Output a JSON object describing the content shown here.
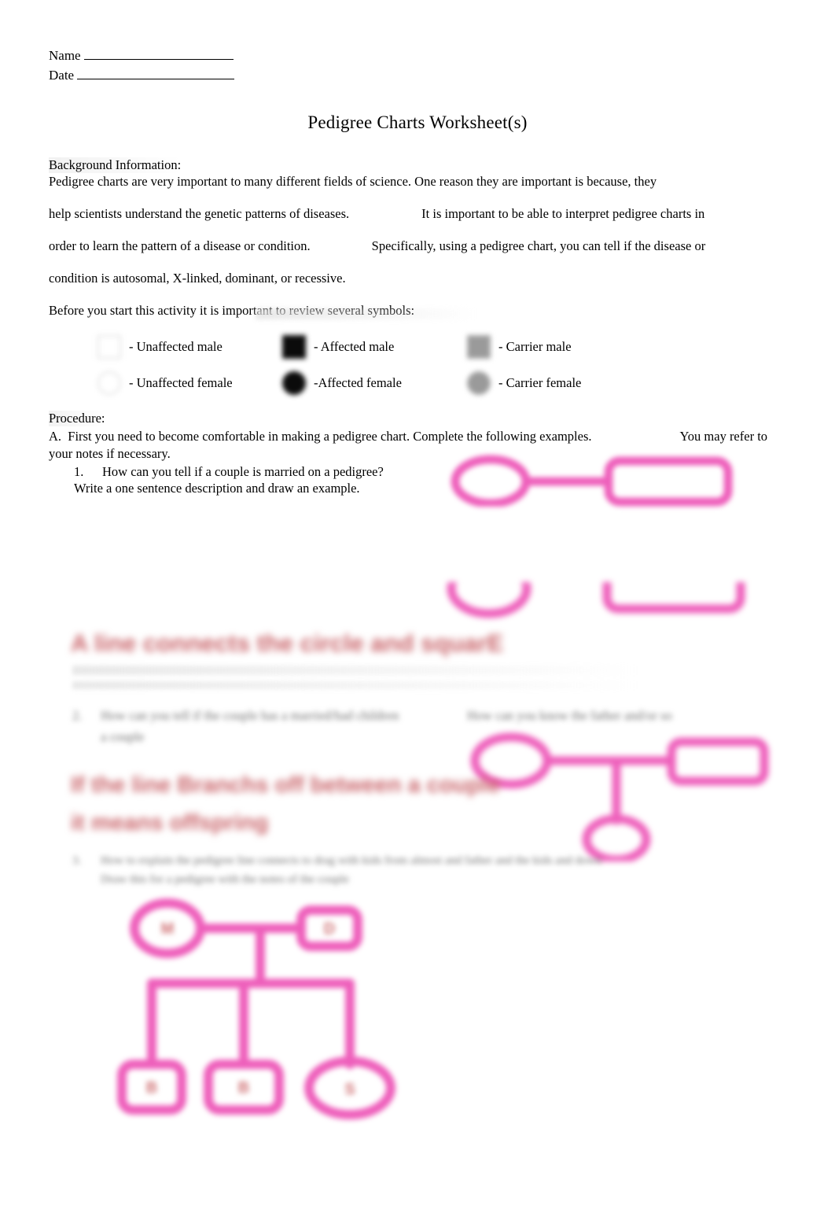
{
  "header": {
    "name_label": "Name",
    "date_label": "Date"
  },
  "title": "Pedigree Charts Worksheet(s)",
  "background": {
    "heading": "Background Information:",
    "line1": "Pedigree charts are very important to many different fields of science. One reason they are important is because, they",
    "line2a": "help scientists understand the genetic patterns of diseases.",
    "line2b": "It is important to be able to interpret pedigree charts in",
    "line3a": "order to learn the pattern of a disease or condition.",
    "line3b": "Specifically, using a pedigree chart, you can tell if the disease or",
    "line4": "condition is autosomal, X-linked, dominant, or recessive."
  },
  "review_line": "Before you start this activity it is important to review several symbols:",
  "legend": {
    "rows": [
      {
        "unaffected": {
          "shape": "square",
          "fill": "unaffected",
          "label": "- Unaffected male"
        },
        "affected": {
          "shape": "square",
          "fill": "affected",
          "label": "- Affected male"
        },
        "carrier": {
          "shape": "square",
          "fill": "carrier",
          "label": "- Carrier male"
        }
      },
      {
        "unaffected": {
          "shape": "circle",
          "fill": "unaffected",
          "label": "- Unaffected female"
        },
        "affected": {
          "shape": "circle",
          "fill": "affected",
          "label": "-Affected female"
        },
        "carrier": {
          "shape": "circle",
          "fill": "carrier",
          "label": "- Carrier female"
        }
      }
    ]
  },
  "procedure": {
    "heading": "Procedure:",
    "item_a_part1": "A.  First you need to become comfortable in making a pedigree chart. Complete the following examples.",
    "item_a_part2": "You may refer to",
    "item_a_line2": "your notes if necessary.",
    "questions": [
      {
        "number": "1.",
        "text": "How can you tell if a couple is married on a pedigree?",
        "subtext": "Write a one sentence description and draw an example.",
        "answer": "A line connects the circle and squarE"
      },
      {
        "number": "2.",
        "text": "How can you tell if the couple has a married/had children",
        "subtext": "a couple",
        "trailing": "How can you know the father and/or so",
        "answer_line1": "If the line Branchs off between a couple",
        "answer_line2": "it means offspring"
      },
      {
        "number": "3.",
        "text": "How to explain the pedigree line connects to drag with kids from almost and father and  the kids and down",
        "subtext": "Draw this for a pedigree with the notes of the couple"
      }
    ]
  },
  "drawings": {
    "accent_color": "#ee5fbb",
    "label_color": "#cf6f72",
    "d1": {
      "name": "married-couple-example",
      "shapes": [
        {
          "type": "circle",
          "role": "female"
        },
        {
          "type": "line",
          "role": "marriage-line"
        },
        {
          "type": "square",
          "role": "male"
        }
      ]
    },
    "d2": {
      "name": "couple-with-one-child-example",
      "shapes": [
        {
          "type": "circle",
          "role": "mother"
        },
        {
          "type": "line",
          "role": "marriage-line"
        },
        {
          "type": "square",
          "role": "father"
        },
        {
          "type": "line",
          "role": "descent-line"
        },
        {
          "type": "circle",
          "role": "child-female"
        }
      ]
    },
    "d3": {
      "name": "family-three-children-example",
      "labels": [
        "M",
        "D",
        "B",
        "B",
        "S"
      ],
      "shapes": [
        {
          "type": "circle",
          "role": "mother",
          "label": "M"
        },
        {
          "type": "square",
          "role": "father",
          "label": "D"
        },
        {
          "type": "square",
          "role": "child-male-1",
          "label": "B"
        },
        {
          "type": "square",
          "role": "child-male-2",
          "label": "B"
        },
        {
          "type": "circle",
          "role": "child-female",
          "label": "S"
        }
      ]
    }
  }
}
